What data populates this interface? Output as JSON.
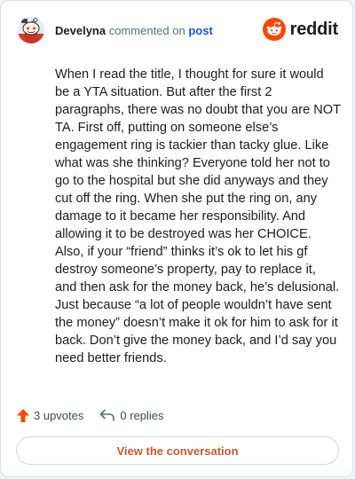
{
  "header": {
    "username": "Develyna",
    "action_text": "commented on",
    "post_link": "post",
    "brand": "reddit"
  },
  "comment": {
    "body": "When I read the title, I thought for sure it would be a YTA situation. But after the first 2 paragraphs, there was no doubt that you are NOT TA. First off, putting on someone else’s engagement ring is tackier than tacky glue. Like what was she thinking? Everyone told her not to go to the hospital but she did anyways and they cut off the ring. When she put the ring on, any damage to it became her responsibility. And allowing it to be destroyed was her CHOICE. Also, if your “friend” thinks it’s ok to let his gf destroy someone’s property, pay to replace it, and then ask for the money back, he’s delusional. Just because “a lot of people wouldn’t have sent the money” doesn’t make it ok for him to ask for it back. Don’t give the money back, and I’d say you need better friends."
  },
  "actions": {
    "upvotes": "3 upvotes",
    "replies": "0 replies"
  },
  "cta": {
    "label": "View the conversation"
  },
  "colors": {
    "reddit_orange": "#ff4500",
    "upvote": "#ff4500",
    "cta_text": "#c85a2a",
    "link_blue": "#1a55c7"
  },
  "icons": {
    "avatar": "snoo-avatar",
    "brand": "reddit-logo-icon",
    "upvote": "upvote-arrow-icon",
    "reply": "reply-arrow-icon"
  }
}
